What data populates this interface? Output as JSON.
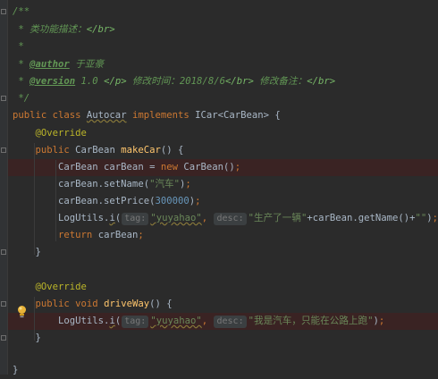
{
  "editor": {
    "lines": [
      [
        {
          "t": "/**",
          "c": "comment"
        }
      ],
      [
        {
          "t": " * ",
          "c": "comment"
        },
        {
          "t": "类功能描述：",
          "c": "comment"
        },
        {
          "t": "</br>",
          "c": "ctag"
        }
      ],
      [
        {
          "t": " *",
          "c": "comment"
        }
      ],
      [
        {
          "t": " * ",
          "c": "comment"
        },
        {
          "t": "@author",
          "c": "jdtag"
        },
        {
          "t": " 于亚豪",
          "c": "comment"
        }
      ],
      [
        {
          "t": " * ",
          "c": "comment"
        },
        {
          "t": "@version",
          "c": "jdtag"
        },
        {
          "t": " 1.0 ",
          "c": "comment"
        },
        {
          "t": "</p>",
          "c": "ctag"
        },
        {
          "t": " 修改时间：2018/8/6",
          "c": "comment"
        },
        {
          "t": "</br>",
          "c": "ctag"
        },
        {
          "t": " 修改备注：",
          "c": "comment"
        },
        {
          "t": "</br>",
          "c": "ctag"
        }
      ],
      [
        {
          "t": " */",
          "c": "comment"
        }
      ],
      [
        {
          "t": "public class ",
          "c": "kw"
        },
        {
          "t": "Autocar",
          "c": "plain sq"
        },
        {
          "t": " implements ",
          "c": "kw"
        },
        {
          "t": "ICar<CarBean> {",
          "c": "plain"
        }
      ],
      [
        {
          "t": "    "
        },
        {
          "t": "@Override",
          "c": "ann"
        }
      ],
      [
        {
          "t": "    "
        },
        {
          "t": "public ",
          "c": "kw"
        },
        {
          "t": "CarBean ",
          "c": "plain"
        },
        {
          "t": "makeCar",
          "c": "method"
        },
        {
          "t": "() {",
          "c": "plain"
        }
      ],
      [
        {
          "t": "        CarBean carBean = ",
          "c": "plain"
        },
        {
          "t": "new ",
          "c": "kw"
        },
        {
          "t": "CarBean()",
          "c": "plain"
        },
        {
          "t": ";",
          "c": "kw"
        }
      ],
      [
        {
          "t": "        carBean.setName(",
          "c": "plain"
        },
        {
          "t": "\"汽车\"",
          "c": "str"
        },
        {
          "t": ")",
          "c": "plain"
        },
        {
          "t": ";",
          "c": "kw"
        }
      ],
      [
        {
          "t": "        carBean.setPrice(",
          "c": "plain"
        },
        {
          "t": "300000",
          "c": "num"
        },
        {
          "t": ")",
          "c": "plain"
        },
        {
          "t": ";",
          "c": "kw"
        }
      ],
      [
        {
          "t": "        LogUtils.",
          "c": "plain"
        },
        {
          "t": "i",
          "c": "plain sq"
        },
        {
          "t": "(",
          "c": "plain"
        },
        {
          "t": "tag:",
          "c": "hint"
        },
        {
          "t": "\"yuyahao\"",
          "c": "str sq"
        },
        {
          "t": ", ",
          "c": "kw"
        },
        {
          "t": "desc:",
          "c": "hint"
        },
        {
          "t": "\"生产了一辆\"",
          "c": "str"
        },
        {
          "t": "+carBean.getName()+",
          "c": "plain"
        },
        {
          "t": "\"\"",
          "c": "str"
        },
        {
          "t": ")",
          "c": "plain"
        },
        {
          "t": ";",
          "c": "kw"
        }
      ],
      [
        {
          "t": "        "
        },
        {
          "t": "return ",
          "c": "kw"
        },
        {
          "t": "carBean",
          "c": "plain"
        },
        {
          "t": ";",
          "c": "kw"
        }
      ],
      [
        {
          "t": "    }",
          "c": "plain"
        }
      ],
      [
        {
          "t": ""
        }
      ],
      [
        {
          "t": "    "
        },
        {
          "t": "@Override",
          "c": "ann"
        }
      ],
      [
        {
          "t": "    "
        },
        {
          "t": "public void ",
          "c": "kw"
        },
        {
          "t": "driveWay",
          "c": "method"
        },
        {
          "t": "() {",
          "c": "plain"
        }
      ],
      [
        {
          "t": "        LogUtils.",
          "c": "plain"
        },
        {
          "t": "i",
          "c": "plain sq"
        },
        {
          "t": "(",
          "c": "plain"
        },
        {
          "t": "tag:",
          "c": "hint"
        },
        {
          "t": "\"yuyahao\"",
          "c": "str sq"
        },
        {
          "t": ", ",
          "c": "kw"
        },
        {
          "t": "desc:",
          "c": "hint"
        },
        {
          "t": "\"我是汽车，只能在公路上跑\"",
          "c": "str"
        },
        {
          "t": ")",
          "c": "plain"
        },
        {
          "t": ";",
          "c": "kw"
        }
      ],
      [
        {
          "t": "    }",
          "c": "plain"
        }
      ],
      [
        {
          "t": ""
        }
      ],
      [
        {
          "t": "}",
          "c": "plain"
        }
      ]
    ],
    "highlighted_lines": [
      9,
      18
    ],
    "fold_marker_lines": [
      0,
      5,
      8,
      14,
      17,
      19
    ]
  },
  "colors": {
    "background": "#2b2b2b",
    "keyword": "#cc7832",
    "string": "#6a8759",
    "comment": "#629755",
    "annotation": "#bbb529",
    "method": "#ffc66d",
    "number": "#6897bb"
  },
  "icons": {
    "gutter": "lightbulb-icon"
  }
}
